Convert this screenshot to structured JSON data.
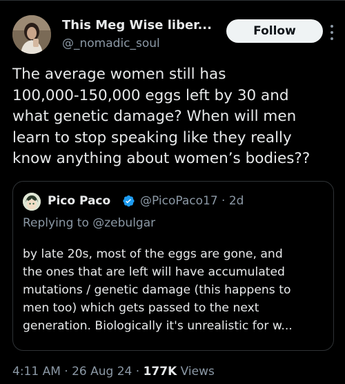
{
  "author": {
    "display_name": "This Meg Wise liber...",
    "handle": "@_nomadic_soul",
    "follow_label": "Follow"
  },
  "tweet": {
    "lines": [
      "The average women still has",
      "100,000-150,000 eggs left by 30 and",
      "what genetic damage? When will men",
      "learn to stop speaking like they really",
      "know anything about women’s bodies??"
    ]
  },
  "quoted": {
    "display_name": "Pico Paco",
    "handle_time": "@PicoPaco17 · 2d",
    "replying_prefix": "Replying to ",
    "replying_to": "@zebulgar",
    "lines": [
      "by late 20s, most of the eggs are gone, and",
      "the ones that are left will have accumulated",
      "mutations / genetic damage (this happens to",
      "men too) which gets passed to the next",
      "generation. Biologically it's unrealistic for w..."
    ]
  },
  "meta": {
    "timestamp": "4:11 AM · 26 Aug 24 · ",
    "views_count": "177K",
    "views_label": " Views"
  },
  "icons": {
    "verified": "verified-badge-icon",
    "more": "more-options-icon"
  },
  "colors": {
    "background": "#000000",
    "text": "#e7e9ea",
    "muted": "#8b98a5",
    "verified_blue": "#1d9bf0"
  }
}
